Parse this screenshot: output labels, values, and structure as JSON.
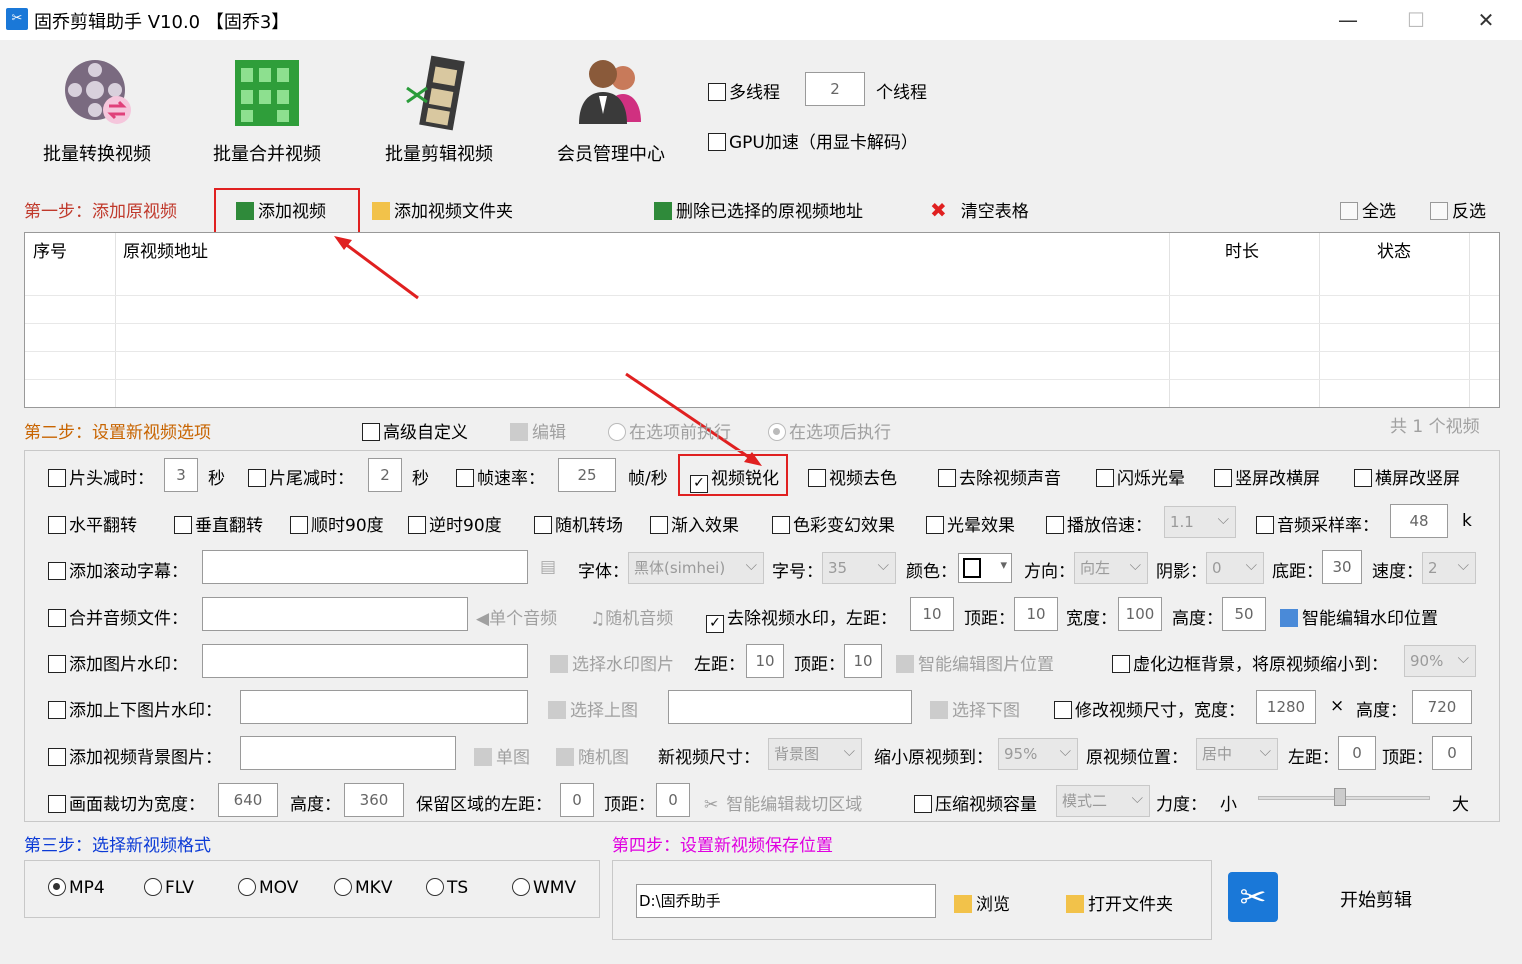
{
  "window": {
    "title": "固乔剪辑助手 V10.0 【固乔3】",
    "minimize": "—",
    "maximize": "☐",
    "close": "✕"
  },
  "toolbar": {
    "batch_convert": "批量转换视频",
    "batch_merge": "批量合并视频",
    "batch_clip": "批量剪辑视频",
    "member_center": "会员管理中心"
  },
  "options_top": {
    "multithread": "多线程",
    "thread_count": "2",
    "thread_unit": "个线程",
    "gpu": "GPU加速（用显卡解码）"
  },
  "step1": {
    "label": "第一步：添加原视频",
    "add_video": "添加视频",
    "add_folder": "添加视频文件夹",
    "delete_selected": "删除已选择的原视频地址",
    "clear_table": "清空表格",
    "select_all": "全选",
    "invert": "反选"
  },
  "table": {
    "columns": [
      "序号",
      "原视频地址",
      "时长",
      "状态"
    ]
  },
  "step2": {
    "label": "第二步：设置新视频选项",
    "advanced": "高级自定义",
    "edit": "编辑",
    "before": "在选项前执行",
    "after": "在选项后执行",
    "count": "共 1 个视频"
  },
  "row1": {
    "head_cut": "片头减时：",
    "head_val": "3",
    "sec1": "秒",
    "tail_cut": "片尾减时：",
    "tail_val": "2",
    "sec2": "秒",
    "fps": "帧速率：",
    "fps_val": "25",
    "fps_unit": "帧/秒",
    "sharpen": "视频锐化",
    "decolor": "视频去色",
    "remove_audio": "去除视频声音",
    "flicker": "闪烁光晕",
    "v2h": "竖屏改横屏",
    "h2v": "横屏改竖屏"
  },
  "row2": {
    "hflip": "水平翻转",
    "vflip": "垂直翻转",
    "cw90": "顺时90度",
    "ccw90": "逆时90度",
    "random_trans": "随机转场",
    "fade_in": "渐入效果",
    "color_fx": "色彩变幻效果",
    "halo": "光晕效果",
    "speed": "播放倍速：",
    "speed_val": "1.1",
    "sample": "音频采样率：",
    "sample_val": "48",
    "sample_unit": "k"
  },
  "row3": {
    "scroll_sub": "添加滚动字幕：",
    "font": "字体：",
    "font_val": "黑体(simhei)",
    "size": "字号：",
    "size_val": "35",
    "color": "颜色：",
    "direction": "方向：",
    "direction_val": "向左",
    "shadow": "阴影：",
    "shadow_val": "0",
    "bottom": "底距：",
    "bottom_val": "30",
    "speed": "速度：",
    "speed_val": "2"
  },
  "row4": {
    "merge_audio": "合并音频文件：",
    "single_audio": "单个音频",
    "random_audio": "随机音频",
    "remove_wm": "去除视频水印，左距：",
    "left_val": "10",
    "top": "顶距：",
    "top_val": "10",
    "width": "宽度：",
    "width_val": "100",
    "height": "高度：",
    "height_val": "50",
    "smart_wm": "智能编辑水印位置"
  },
  "row5": {
    "img_wm": "添加图片水印：",
    "select_wm": "选择水印图片",
    "left": "左距：",
    "left_val": "10",
    "top": "顶距：",
    "top_val": "10",
    "smart_img": "智能编辑图片位置",
    "blur_bg": "虚化边框背景，将原视频缩小到：",
    "blur_val": "90%"
  },
  "row6": {
    "topbottom": "添加上下图片水印：",
    "select_top": "选择上图",
    "select_bottom": "选择下图",
    "resize": "修改视频尺寸，宽度：",
    "w_val": "1280",
    "x": "×",
    "height": "高度：",
    "h_val": "720"
  },
  "row7": {
    "bg_img": "添加视频背景图片：",
    "single": "单图",
    "random": "随机图",
    "new_size": "新视频尺寸：",
    "new_size_val": "背景图",
    "shrink": "缩小原视频到：",
    "shrink_val": "95%",
    "pos": "原视频位置：",
    "pos_val": "居中",
    "left": "左距：",
    "left_val": "0",
    "top": "顶距：",
    "top_val": "0"
  },
  "row8": {
    "crop": "画面裁切为宽度：",
    "crop_w": "640",
    "height": "高度：",
    "crop_h": "360",
    "keep_left": "保留区域的左距：",
    "kl_val": "0",
    "top": "顶距：",
    "top_val": "0",
    "smart_crop": "智能编辑裁切区域",
    "compress": "压缩视频容量",
    "mode_val": "模式二",
    "strength": "力度：",
    "small": "小",
    "large": "大"
  },
  "step3": {
    "label": "第三步：选择新视频格式",
    "formats": [
      "MP4",
      "FLV",
      "MOV",
      "MKV",
      "TS",
      "WMV"
    ]
  },
  "step4": {
    "label": "第四步：设置新视频保存位置",
    "path": "D:\\固乔助手",
    "browse": "浏览",
    "open_folder": "打开文件夹",
    "start": "开始剪辑"
  },
  "colors": {
    "step_red": "#c0392b",
    "step_orange": "#c86400",
    "step_blue": "#0b3ad6",
    "step_magenta": "#e000e0",
    "highlight": "#e02020"
  }
}
